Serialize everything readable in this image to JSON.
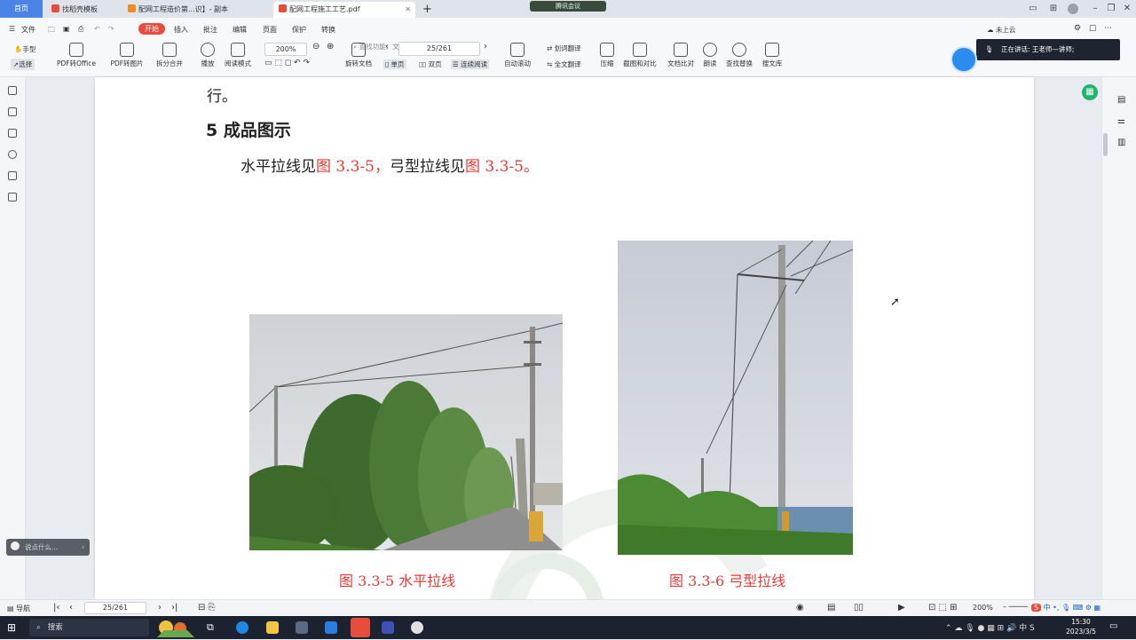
{
  "tabs": {
    "home": "首页",
    "tab1": "找稻壳模板",
    "tab2": "配网工程造价第...识】- 副本",
    "tab3": "配网工程施工工艺.pdf"
  },
  "meeting_label": "腾讯会议",
  "ribbon": {
    "file": "文件",
    "menus": [
      "开始",
      "插入",
      "批注",
      "编辑",
      "页面",
      "保护",
      "转换"
    ],
    "search_hint": "查找功能、文档内容",
    "cloud": "未上云",
    "share": "分享",
    "hand_tool": "手型",
    "select_tool": "选择",
    "tools": [
      "PDF转Office",
      "PDF转图片",
      "拆分合并",
      "播放",
      "阅读模式"
    ],
    "zoom": "200%",
    "rotate": "旋转文档",
    "single_page": "单页",
    "double_page": "双页",
    "continuous": "连续阅读",
    "page_indicator": "25/261",
    "auto_scroll": "自动滚动",
    "translate_word": "划词翻译",
    "translate_full": "全文翻译",
    "compress": "压缩",
    "screenshot_compare": "截图和对比",
    "doc_compare": "文档比对",
    "read_aloud": "朗读",
    "find_replace": "查找替换",
    "search_library": "搜文库"
  },
  "speaking": "正在讲话: 王老师—讲师;",
  "document": {
    "line_end": "行。",
    "heading": "5  成品图示",
    "para_prefix": "水平拉线见",
    "para_ref1": "图 3.3-5，",
    "para_mid": "弓型拉线见",
    "para_ref2": "图 3.3-5。",
    "caption1": "图 3.3-5 水平拉线",
    "caption2": "图 3.3-6 弓型拉线"
  },
  "comment_placeholder": "说点什么...",
  "statusbar": {
    "nav": "导航",
    "page": "25/261",
    "zoom": "200%"
  },
  "taskbar": {
    "search": "搜索",
    "ime": "中",
    "time": "15:30",
    "date": "2023/3/5"
  },
  "colors": {
    "accent_red": "#e53935",
    "home_tab": "#4a83e6",
    "edge_green": "#3cc36b"
  }
}
